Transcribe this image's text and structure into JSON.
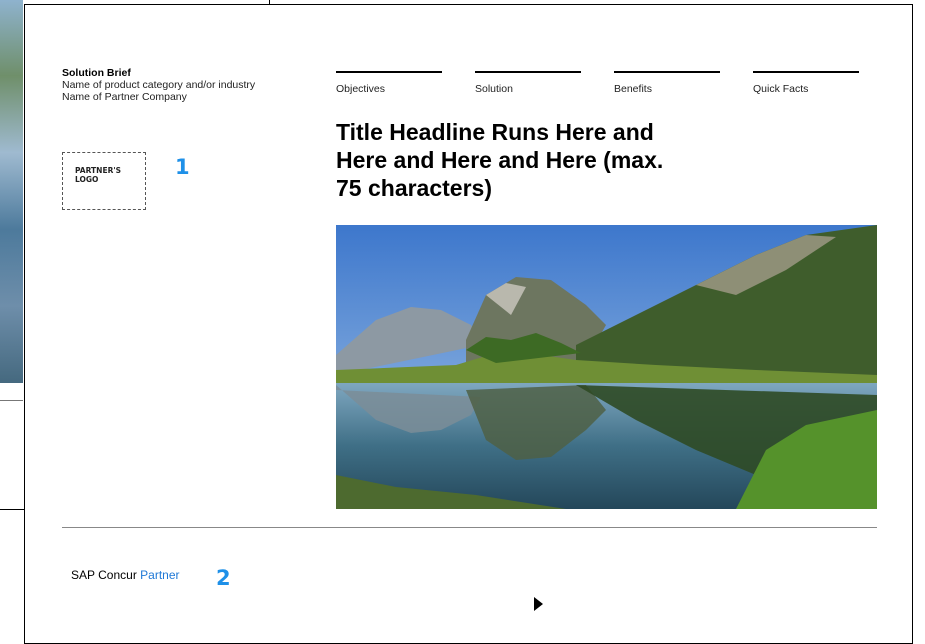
{
  "solution_brief": {
    "title": "Solution Brief",
    "line1": "Name of product category and/or industry",
    "line2": "Name of Partner Company"
  },
  "logo_placeholder": {
    "line1": "PARTNER'S",
    "line2": "LOGO"
  },
  "callouts": {
    "one": "1",
    "two": "2"
  },
  "nav": [
    "Objectives",
    "Solution",
    "Benefits",
    "Quick Facts"
  ],
  "headline": {
    "line1": "Title Headline Runs Here and",
    "line2": "Here and Here and Here (max.",
    "line3": "75 characters)"
  },
  "footer": {
    "brand": "SAP Concur",
    "brand_accent": "Partner"
  },
  "colors": {
    "accent": "#1e90e8",
    "brand_blue": "#1e78d6"
  },
  "icons": {
    "cursor": "pointer-arrow-icon"
  }
}
